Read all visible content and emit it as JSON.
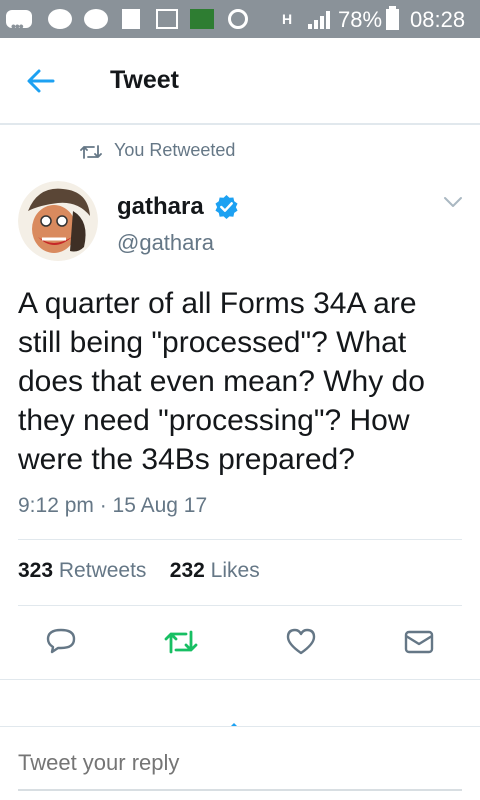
{
  "statusbar": {
    "battery": "78%",
    "time": "08:28",
    "network": "H",
    "icons": [
      "messages-icon",
      "chat-icon",
      "messenger-icon",
      "facebook-icon",
      "gallery-icon",
      "news-icon",
      "chrome-icon"
    ]
  },
  "header": {
    "title": "Tweet"
  },
  "retweet_notice": "You Retweeted",
  "author": {
    "name": "gathara",
    "handle": "@gathara",
    "verified": true
  },
  "tweet": {
    "text": "A quarter of all Forms 34A are still being \"processed\"? What does that even mean? Why do they need \"processing\"? How were the 34Bs prepared?",
    "timestamp": "9:12 pm · 15 Aug 17"
  },
  "stats": {
    "retweets_count": "323",
    "retweets_label": "Retweets",
    "likes_count": "232",
    "likes_label": "Likes"
  },
  "reply": {
    "placeholder": "Tweet your reply"
  },
  "colors": {
    "accent": "#1da1f2",
    "retweet_green": "#17bf63",
    "muted": "#657786",
    "statusbar": "#8a9299"
  }
}
